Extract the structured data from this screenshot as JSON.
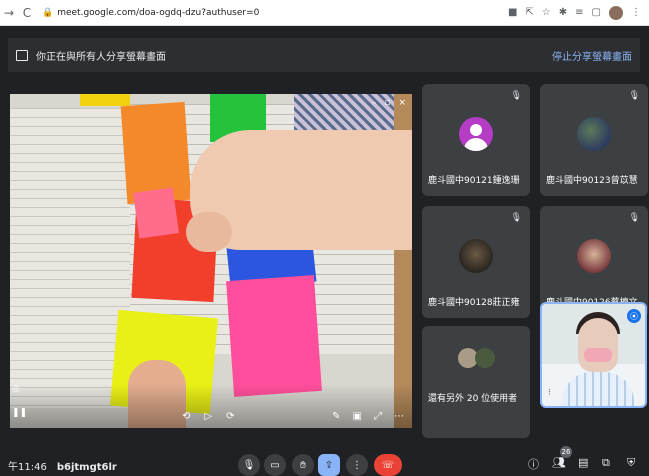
{
  "browser": {
    "back_icon": "arrow-right-icon",
    "reload_icon": "reload-icon",
    "url": "meet.google.com/doa-ogdq-dzu?authuser=0",
    "icons": [
      "video-icon",
      "share-icon",
      "star-icon",
      "extension-icon",
      "queue-icon",
      "square-icon"
    ]
  },
  "share_banner": {
    "text": "你正在與所有人分享螢幕畫面",
    "stop_label": "停止分享螢幕畫面"
  },
  "participants": [
    {
      "name": "鹿斗國中90121鍾逸珊",
      "avatar": "default-person-avatar"
    },
    {
      "name": "鹿斗國中90123曾苡慧",
      "avatar": "photo-avatar"
    },
    {
      "name": "鹿斗國中90128莊正雍",
      "avatar": "photo-avatar"
    },
    {
      "name": "鹿斗國中90126蔡檀文",
      "avatar": "photo-avatar"
    },
    {
      "name": "還有另外 20 位使用者",
      "avatar": "group-avatar"
    }
  ],
  "meeting": {
    "time": "午11:46",
    "code": "b6jtmgt6lr",
    "participant_count": "26"
  },
  "colors": {
    "background": "#202124",
    "tile": "#3c4043",
    "accent": "#8ab4f8",
    "hangup": "#ea4335"
  }
}
